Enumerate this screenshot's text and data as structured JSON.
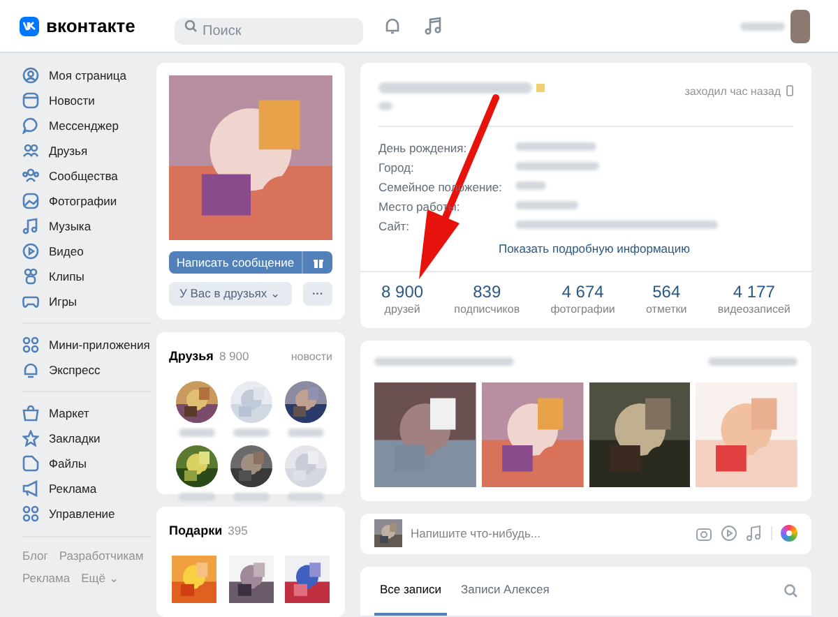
{
  "header": {
    "logo": "вконтакте",
    "search": {
      "placeholder": "Поиск"
    }
  },
  "sidebar": {
    "groups": [
      [
        {
          "label": "Моя страница"
        },
        {
          "label": "Новости"
        },
        {
          "label": "Мессенджер"
        },
        {
          "label": "Друзья"
        },
        {
          "label": "Сообщества"
        },
        {
          "label": "Фотографии"
        },
        {
          "label": "Музыка"
        },
        {
          "label": "Видео"
        },
        {
          "label": "Клипы"
        },
        {
          "label": "Игры"
        }
      ],
      [
        {
          "label": "Мини-приложения"
        },
        {
          "label": "Экспресс"
        }
      ],
      [
        {
          "label": "Маркет"
        },
        {
          "label": "Закладки"
        },
        {
          "label": "Файлы"
        },
        {
          "label": "Реклама"
        },
        {
          "label": "Управление"
        }
      ]
    ],
    "footer_links": [
      "Блог",
      "Разработчикам",
      "Реклама",
      "Ещё ⌄"
    ]
  },
  "profile_card": {
    "message_button": "Написать сообщение",
    "friends_button": "У Вас в друзьях ⌄",
    "more_button": "···"
  },
  "friends_card": {
    "title": "Друзья",
    "count": "8 900",
    "link": "новости"
  },
  "gifts_card": {
    "title": "Подарки",
    "count": "395"
  },
  "info_card": {
    "last_seen": "заходил час назад",
    "fields": [
      "День рождения:",
      "Город:",
      "Семейное положение:",
      "Место работы:",
      "Сайт:"
    ],
    "more_link": "Показать подробную информацию",
    "counters": [
      {
        "value": "8 900",
        "label": "друзей"
      },
      {
        "value": "839",
        "label": "подписчиков"
      },
      {
        "value": "4 674",
        "label": "фотографии"
      },
      {
        "value": "564",
        "label": "отметки"
      },
      {
        "value": "4 177",
        "label": "видеозаписей"
      }
    ]
  },
  "post_box": {
    "placeholder": "Напишите что-нибудь..."
  },
  "wall_tabs": [
    {
      "label": "Все записи",
      "selected": true
    },
    {
      "label": "Записи Алексея",
      "selected": false
    }
  ]
}
